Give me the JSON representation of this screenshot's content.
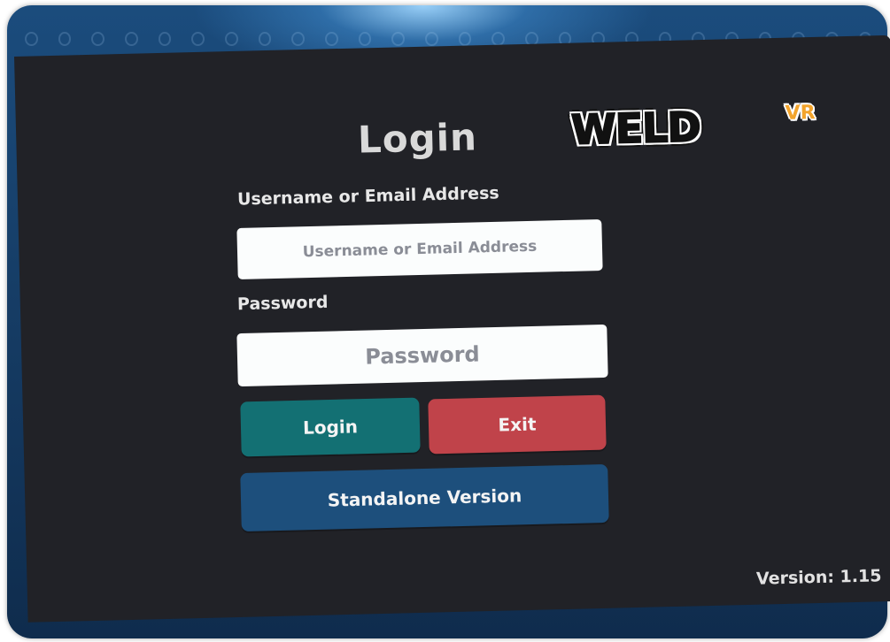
{
  "brand": {
    "logo_main": "WELD",
    "logo_sub": "VR",
    "logo_sub_color": "#f3a42c"
  },
  "form": {
    "title": "Login",
    "username_label": "Username or Email Address",
    "username_placeholder": "Username or Email Address",
    "password_label": "Password",
    "password_placeholder": "Password"
  },
  "buttons": {
    "login": "Login",
    "exit": "Exit",
    "standalone": "Standalone Version"
  },
  "colors": {
    "panel": "#212227",
    "login_button": "#137073",
    "exit_button": "#c0434a",
    "standalone_button": "#1d4f7c",
    "background": "#163d66"
  },
  "footer": {
    "version": "Version: 1.15"
  }
}
